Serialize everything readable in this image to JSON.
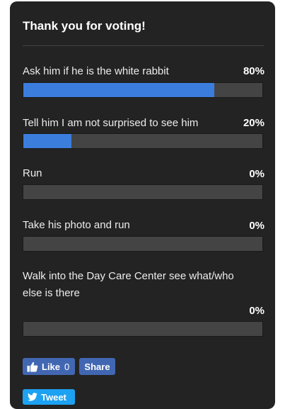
{
  "poll": {
    "title": "Thank you for voting!",
    "options": [
      {
        "label": "Ask him if he is the white rabbit",
        "percent": "80%",
        "fill": 0.8
      },
      {
        "label": "Tell him I am not surprised to see him",
        "percent": "20%",
        "fill": 0.2
      },
      {
        "label": "Run",
        "percent": "0%",
        "fill": 0
      },
      {
        "label": "Take his photo and run",
        "percent": "0%",
        "fill": 0
      },
      {
        "label": "Walk into the Day Care Center see what/who else is there",
        "percent": "0%",
        "fill": 0
      }
    ]
  },
  "social": {
    "like_label": "Like",
    "like_count": "0",
    "share_label": "Share",
    "tweet_label": "Tweet"
  },
  "colors": {
    "card_background": "#232323",
    "bar_fill": "#3b7ddd",
    "bar_track": "#444444",
    "facebook": "#4267b2",
    "twitter": "#1da1f2"
  }
}
